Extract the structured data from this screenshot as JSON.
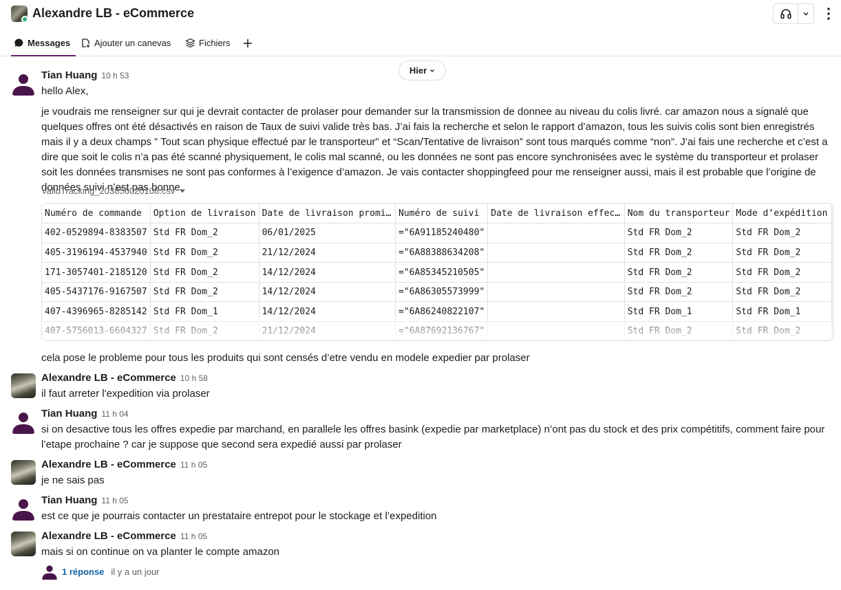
{
  "header": {
    "title": "Alexandre LB - eCommerce"
  },
  "tabs": [
    {
      "label": "Messages",
      "icon": "message-bubble-icon"
    },
    {
      "label": "Ajouter un canevas",
      "icon": "canvas-icon"
    },
    {
      "label": "Fichiers",
      "icon": "layers-icon"
    }
  ],
  "date_divider": "Hier",
  "messages": [
    {
      "sender": "Tian Huang",
      "time": "10 h 53",
      "lines": [
        "hello Alex,",
        "je voudrais me renseigner sur qui je devrait contacter de prolaser pour demander sur la transmission de donnee au niveau du colis livré. car amazon nous a signalé que quelques offres ont été désactivés en raison de Taux de suivi valide très bas. J’ai fais la recherche et selon le rapport d’amazon, tous les suivis colis sont bien enregistrés mais il y a deux champs ” Tout scan physique effectué par le transporteur” et “Scan/Tentative de livraison” sont tous marqués comme “non”. J’ai fais une recherche et c’est a dire que soit le colis n’a pas été scanné physiquement, le colis mal scanné, ou les données ne sont pas encore synchronisées avec le système du transporteur et prolaser soit les données transmises ne sont pas conformes à l’exigence d’amazon. Je vais contacter shoppingfeed pour me renseigner aussi, mais il est probable que l’origine de données suivi n’est pas bonne."
      ],
      "file": {
        "name": "ValidTracking_203856020108.csv",
        "headers": [
          "Numéro de commande",
          "Option de livraison",
          "Date de livraison promi…",
          "Numéro de suivi",
          "Date de livraison effec…",
          "Nom du transporteur",
          "Mode d’expédition"
        ],
        "rows": [
          [
            "402-0529894-8383507",
            "Std FR Dom_2",
            "06/01/2025",
            "=\"6A91185240480\"",
            "",
            "Std FR Dom_2",
            "Std FR Dom_2"
          ],
          [
            "405-3196194-4537940",
            "Std FR Dom_2",
            "21/12/2024",
            "=\"6A88388634208\"",
            "",
            "Std FR Dom_2",
            "Std FR Dom_2"
          ],
          [
            "171-3057401-2185120",
            "Std FR Dom_2",
            "14/12/2024",
            "=\"6A85345210505\"",
            "",
            "Std FR Dom_2",
            "Std FR Dom_2"
          ],
          [
            "405-5437176-9167507",
            "Std FR Dom_2",
            "14/12/2024",
            "=\"6A86305573999\"",
            "",
            "Std FR Dom_2",
            "Std FR Dom_2"
          ],
          [
            "407-4396965-8285142",
            "Std FR Dom_1",
            "14/12/2024",
            "=\"6A86240822107\"",
            "",
            "Std FR Dom_1",
            "Std FR Dom_1"
          ],
          [
            "407-5756013-6604327",
            "Std FR Dom_2",
            "21/12/2024",
            "=\"6A87692136767\"",
            "",
            "Std FR Dom_2",
            "Std FR Dom_2"
          ]
        ]
      },
      "followup": "cela pose le probleme pour tous les produits qui sont censés d’etre vendu en modele expedier par prolaser"
    },
    {
      "sender": "Alexandre LB - eCommerce",
      "time": "10 h 58",
      "text": "il faut arreter l'expedition via prolaser"
    },
    {
      "sender": "Tian Huang",
      "time": "11 h 04",
      "text": "si on desactive tous les offres expedie par marchand, en parallele les offres basink (expedie par marketplace) n’ont pas du stock et des prix compétitifs, comment faire pour l’etape prochaine ? car je suppose que second sera expedié aussi par prolaser"
    },
    {
      "sender": "Alexandre LB - eCommerce",
      "time": "11 h 05",
      "text": "je ne sais pas"
    },
    {
      "sender": "Tian Huang",
      "time": "11 h 05",
      "text": "est ce que je pourrais contacter un prestataire entrepot pour le stockage et l’expedition"
    },
    {
      "sender": "Alexandre LB - eCommerce",
      "time": "11 h 05",
      "text": "mais si on continue on va planter le compte amazon",
      "thread": {
        "replies": "1 réponse",
        "last": "il y a un jour"
      }
    }
  ],
  "colors": {
    "accent": "#611f69",
    "link": "#1264a3",
    "online": "#2bac76"
  }
}
